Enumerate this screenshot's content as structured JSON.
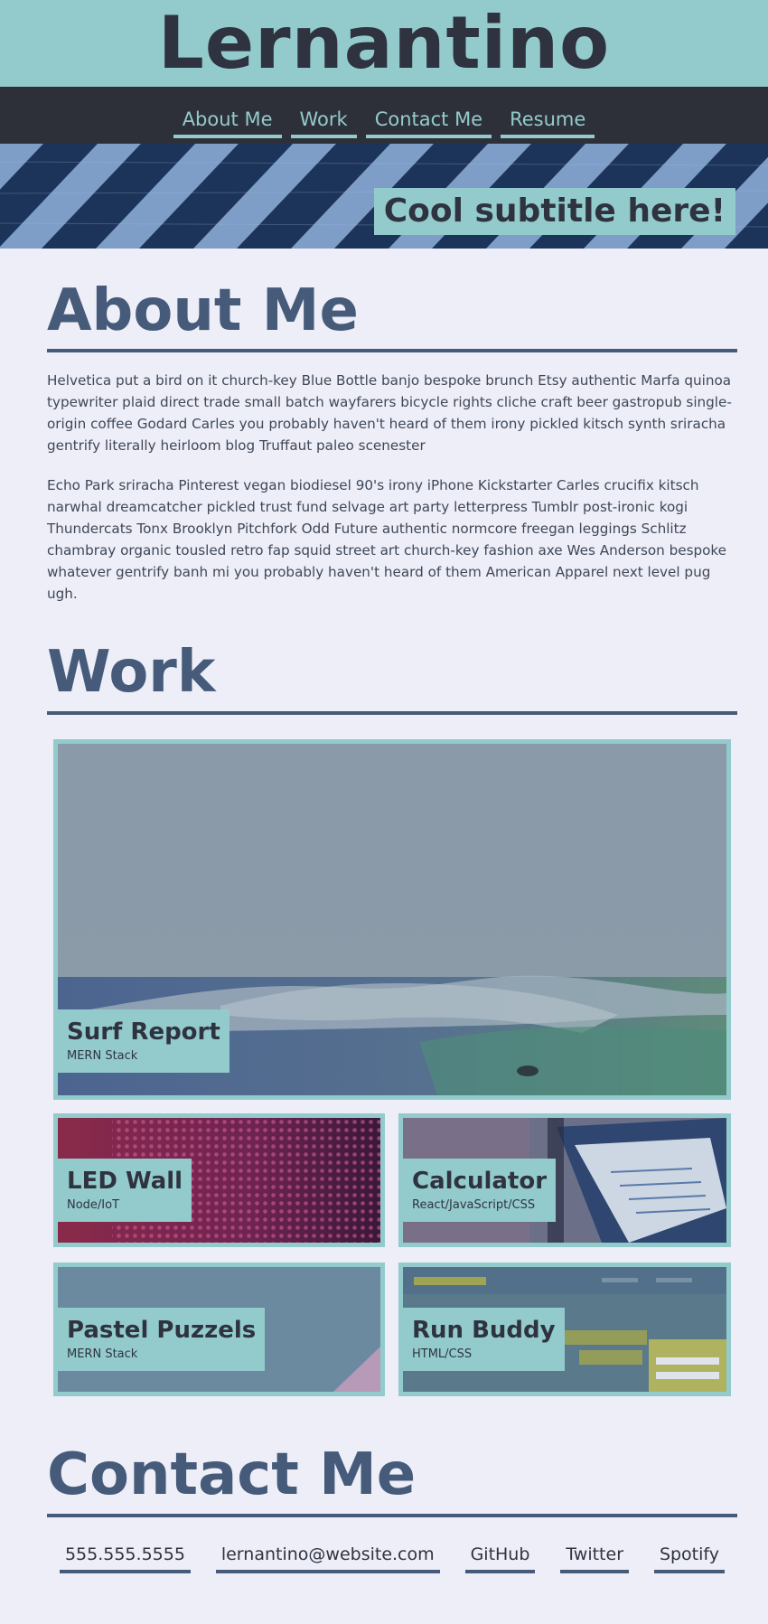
{
  "header": {
    "title": "Lernantino"
  },
  "nav": {
    "items": [
      {
        "label": "About Me"
      },
      {
        "label": "Work"
      },
      {
        "label": "Contact Me"
      },
      {
        "label": "Resume"
      }
    ]
  },
  "hero": {
    "subtitle": "Cool subtitle here!"
  },
  "about": {
    "heading": "About Me",
    "paragraphs": [
      "Helvetica put a bird on it church-key Blue Bottle banjo bespoke brunch Etsy authentic Marfa quinoa typewriter plaid direct trade small batch wayfarers bicycle rights cliche craft beer gastropub single-origin coffee Godard Carles you probably haven't heard of them irony pickled kitsch synth sriracha gentrify literally heirloom blog Truffaut paleo scenester",
      "Echo Park sriracha Pinterest vegan biodiesel 90's irony iPhone Kickstarter Carles crucifix kitsch narwhal dreamcatcher pickled trust fund selvage art party letterpress Tumblr post-ironic kogi Thundercats Tonx Brooklyn Pitchfork Odd Future authentic normcore freegan leggings Schlitz chambray organic tousled retro fap squid street art church-key fashion axe Wes Anderson bespoke whatever gentrify banh mi you probably haven't heard of them American Apparel next level pug ugh."
    ]
  },
  "work": {
    "heading": "Work",
    "projects": [
      {
        "title": "Surf Report",
        "tech": "MERN Stack"
      },
      {
        "title": "LED Wall",
        "tech": "Node/IoT"
      },
      {
        "title": "Calculator",
        "tech": "React/JavaScript/CSS"
      },
      {
        "title": "Pastel Puzzels",
        "tech": "MERN Stack"
      },
      {
        "title": "Run Buddy",
        "tech": "HTML/CSS"
      }
    ]
  },
  "contact": {
    "heading": "Contact Me",
    "links": [
      {
        "label": "555.555.5555"
      },
      {
        "label": "lernantino@website.com"
      },
      {
        "label": "GitHub"
      },
      {
        "label": "Twitter"
      },
      {
        "label": "Spotify"
      }
    ]
  },
  "colors": {
    "accent": "#93cbcc",
    "dark": "#2e3039",
    "heading": "#465a7a",
    "background": "#edeef7"
  }
}
